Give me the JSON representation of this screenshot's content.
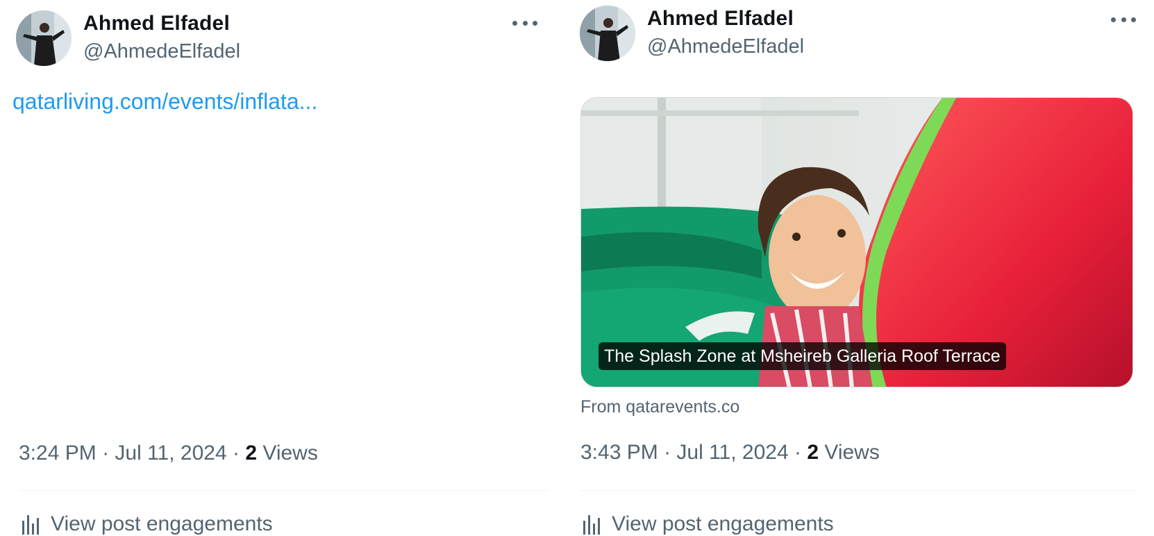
{
  "tweets": [
    {
      "author": {
        "name": "Ahmed Elfadel",
        "handle": "@AhmedeElfadel"
      },
      "link_text": "qatarliving.com/events/inflata...",
      "time": "3:24 PM",
      "date": "Jul 11, 2024",
      "separator": "·",
      "views_count": "2",
      "views_label": "Views",
      "engagements_label": "View post engagements"
    },
    {
      "author": {
        "name": "Ahmed Elfadel",
        "handle": "@AhmedeElfadel"
      },
      "card": {
        "caption": "The Splash Zone at Msheireb Galleria Roof Terrace",
        "source": "From qatarevents.co"
      },
      "time": "3:43 PM",
      "date": "Jul 11, 2024",
      "separator": "·",
      "views_count": "2",
      "views_label": "Views",
      "engagements_label": "View post engagements"
    }
  ],
  "icons": {
    "more": "more-horizontal-icon",
    "engagements": "bar-chart-icon"
  },
  "colors": {
    "link": "#1d9bf0",
    "secondary_text": "#536471",
    "primary_text": "#0f1419",
    "divider": "#eff3f4"
  }
}
